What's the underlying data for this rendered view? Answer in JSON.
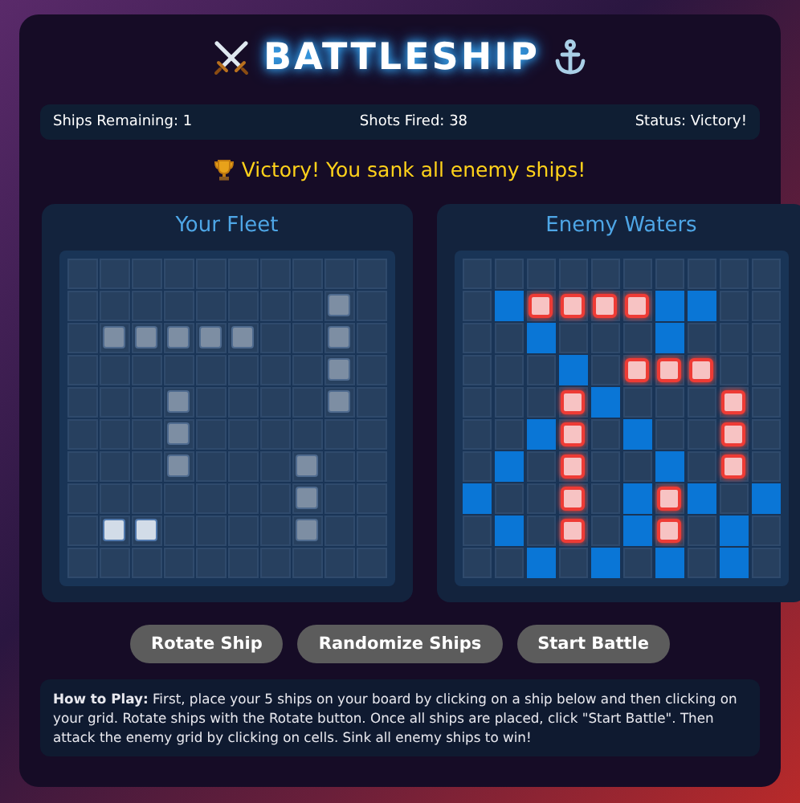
{
  "title": "BATTLESHIP",
  "stats": [
    {
      "label": "Ships Remaining: 1"
    },
    {
      "label": "Shots Fired: 38"
    },
    {
      "label": "Status: Victory!"
    }
  ],
  "message": "Victory! You sank all enemy ships!",
  "boards": [
    {
      "title": "Your Fleet",
      "rows": [
        [
          {
            "kind": "water"
          },
          {
            "kind": "water"
          },
          {
            "kind": "water"
          },
          {
            "kind": "water"
          },
          {
            "kind": "water"
          },
          {
            "kind": "water"
          },
          {
            "kind": "water"
          },
          {
            "kind": "water"
          },
          {
            "kind": "water"
          },
          {
            "kind": "water"
          }
        ],
        [
          {
            "kind": "water"
          },
          {
            "kind": "water"
          },
          {
            "kind": "water"
          },
          {
            "kind": "water"
          },
          {
            "kind": "water"
          },
          {
            "kind": "water"
          },
          {
            "kind": "water"
          },
          {
            "kind": "water"
          },
          {
            "kind": "ship"
          },
          {
            "kind": "water"
          }
        ],
        [
          {
            "kind": "water"
          },
          {
            "kind": "ship"
          },
          {
            "kind": "ship"
          },
          {
            "kind": "ship"
          },
          {
            "kind": "ship"
          },
          {
            "kind": "ship"
          },
          {
            "kind": "water"
          },
          {
            "kind": "water"
          },
          {
            "kind": "ship"
          },
          {
            "kind": "water"
          }
        ],
        [
          {
            "kind": "water"
          },
          {
            "kind": "water"
          },
          {
            "kind": "water"
          },
          {
            "kind": "water"
          },
          {
            "kind": "water"
          },
          {
            "kind": "water"
          },
          {
            "kind": "water"
          },
          {
            "kind": "water"
          },
          {
            "kind": "ship"
          },
          {
            "kind": "water"
          }
        ],
        [
          {
            "kind": "water"
          },
          {
            "kind": "water"
          },
          {
            "kind": "water"
          },
          {
            "kind": "ship"
          },
          {
            "kind": "water"
          },
          {
            "kind": "water"
          },
          {
            "kind": "water"
          },
          {
            "kind": "water"
          },
          {
            "kind": "ship"
          },
          {
            "kind": "water"
          }
        ],
        [
          {
            "kind": "water"
          },
          {
            "kind": "water"
          },
          {
            "kind": "water"
          },
          {
            "kind": "ship"
          },
          {
            "kind": "water"
          },
          {
            "kind": "water"
          },
          {
            "kind": "water"
          },
          {
            "kind": "water"
          },
          {
            "kind": "water"
          },
          {
            "kind": "water"
          }
        ],
        [
          {
            "kind": "water"
          },
          {
            "kind": "water"
          },
          {
            "kind": "water"
          },
          {
            "kind": "ship"
          },
          {
            "kind": "water"
          },
          {
            "kind": "water"
          },
          {
            "kind": "water"
          },
          {
            "kind": "ship"
          },
          {
            "kind": "water"
          },
          {
            "kind": "water"
          }
        ],
        [
          {
            "kind": "water"
          },
          {
            "kind": "water"
          },
          {
            "kind": "water"
          },
          {
            "kind": "water"
          },
          {
            "kind": "water"
          },
          {
            "kind": "water"
          },
          {
            "kind": "water"
          },
          {
            "kind": "ship"
          },
          {
            "kind": "water"
          },
          {
            "kind": "water"
          }
        ],
        [
          {
            "kind": "water"
          },
          {
            "kind": "damaged"
          },
          {
            "kind": "damaged"
          },
          {
            "kind": "water"
          },
          {
            "kind": "water"
          },
          {
            "kind": "water"
          },
          {
            "kind": "water"
          },
          {
            "kind": "ship"
          },
          {
            "kind": "water"
          },
          {
            "kind": "water"
          }
        ],
        [
          {
            "kind": "water"
          },
          {
            "kind": "water"
          },
          {
            "kind": "water"
          },
          {
            "kind": "water"
          },
          {
            "kind": "water"
          },
          {
            "kind": "water"
          },
          {
            "kind": "water"
          },
          {
            "kind": "water"
          },
          {
            "kind": "water"
          },
          {
            "kind": "water"
          }
        ]
      ]
    },
    {
      "title": "Enemy Waters",
      "rows": [
        [
          {
            "kind": "water"
          },
          {
            "kind": "water"
          },
          {
            "kind": "water"
          },
          {
            "kind": "water"
          },
          {
            "kind": "water"
          },
          {
            "kind": "water"
          },
          {
            "kind": "water"
          },
          {
            "kind": "water"
          },
          {
            "kind": "water"
          },
          {
            "kind": "water"
          }
        ],
        [
          {
            "kind": "water"
          },
          {
            "kind": "miss"
          },
          {
            "kind": "hit"
          },
          {
            "kind": "hit"
          },
          {
            "kind": "hit"
          },
          {
            "kind": "hit"
          },
          {
            "kind": "miss"
          },
          {
            "kind": "miss"
          },
          {
            "kind": "water"
          },
          {
            "kind": "water"
          }
        ],
        [
          {
            "kind": "water"
          },
          {
            "kind": "water"
          },
          {
            "kind": "miss"
          },
          {
            "kind": "water"
          },
          {
            "kind": "water"
          },
          {
            "kind": "water"
          },
          {
            "kind": "miss"
          },
          {
            "kind": "water"
          },
          {
            "kind": "water"
          },
          {
            "kind": "water"
          }
        ],
        [
          {
            "kind": "water"
          },
          {
            "kind": "water"
          },
          {
            "kind": "water"
          },
          {
            "kind": "miss"
          },
          {
            "kind": "water"
          },
          {
            "kind": "hit"
          },
          {
            "kind": "hit"
          },
          {
            "kind": "hit"
          },
          {
            "kind": "water"
          },
          {
            "kind": "water"
          }
        ],
        [
          {
            "kind": "water"
          },
          {
            "kind": "water"
          },
          {
            "kind": "water"
          },
          {
            "kind": "hit"
          },
          {
            "kind": "miss"
          },
          {
            "kind": "water"
          },
          {
            "kind": "water"
          },
          {
            "kind": "water"
          },
          {
            "kind": "hit"
          },
          {
            "kind": "water"
          }
        ],
        [
          {
            "kind": "water"
          },
          {
            "kind": "water"
          },
          {
            "kind": "miss"
          },
          {
            "kind": "hit"
          },
          {
            "kind": "water"
          },
          {
            "kind": "miss"
          },
          {
            "kind": "water"
          },
          {
            "kind": "water"
          },
          {
            "kind": "hit"
          },
          {
            "kind": "water"
          }
        ],
        [
          {
            "kind": "water"
          },
          {
            "kind": "miss"
          },
          {
            "kind": "water"
          },
          {
            "kind": "hit"
          },
          {
            "kind": "water"
          },
          {
            "kind": "water"
          },
          {
            "kind": "miss"
          },
          {
            "kind": "water"
          },
          {
            "kind": "hit"
          },
          {
            "kind": "water"
          }
        ],
        [
          {
            "kind": "miss"
          },
          {
            "kind": "water"
          },
          {
            "kind": "water"
          },
          {
            "kind": "hit"
          },
          {
            "kind": "water"
          },
          {
            "kind": "miss"
          },
          {
            "kind": "hit"
          },
          {
            "kind": "miss"
          },
          {
            "kind": "water"
          },
          {
            "kind": "miss"
          }
        ],
        [
          {
            "kind": "water"
          },
          {
            "kind": "miss"
          },
          {
            "kind": "water"
          },
          {
            "kind": "hit"
          },
          {
            "kind": "water"
          },
          {
            "kind": "miss"
          },
          {
            "kind": "hit"
          },
          {
            "kind": "water"
          },
          {
            "kind": "miss"
          },
          {
            "kind": "water"
          }
        ],
        [
          {
            "kind": "water"
          },
          {
            "kind": "water"
          },
          {
            "kind": "miss"
          },
          {
            "kind": "water"
          },
          {
            "kind": "miss"
          },
          {
            "kind": "water"
          },
          {
            "kind": "miss"
          },
          {
            "kind": "water"
          },
          {
            "kind": "miss"
          },
          {
            "kind": "water"
          }
        ]
      ]
    }
  ],
  "buttons": [
    "Rotate Ship",
    "Randomize Ships",
    "Start Battle"
  ],
  "help": "**How to Play:** First, place your 5 ships on your board by clicking on a ship below and then clicking on your grid. Rotate ships with the Rotate button. Once all ships are placed, click \"Start Battle\". Then attack the enemy grid by clicking on cells. Sink all enemy ships to win!"
}
